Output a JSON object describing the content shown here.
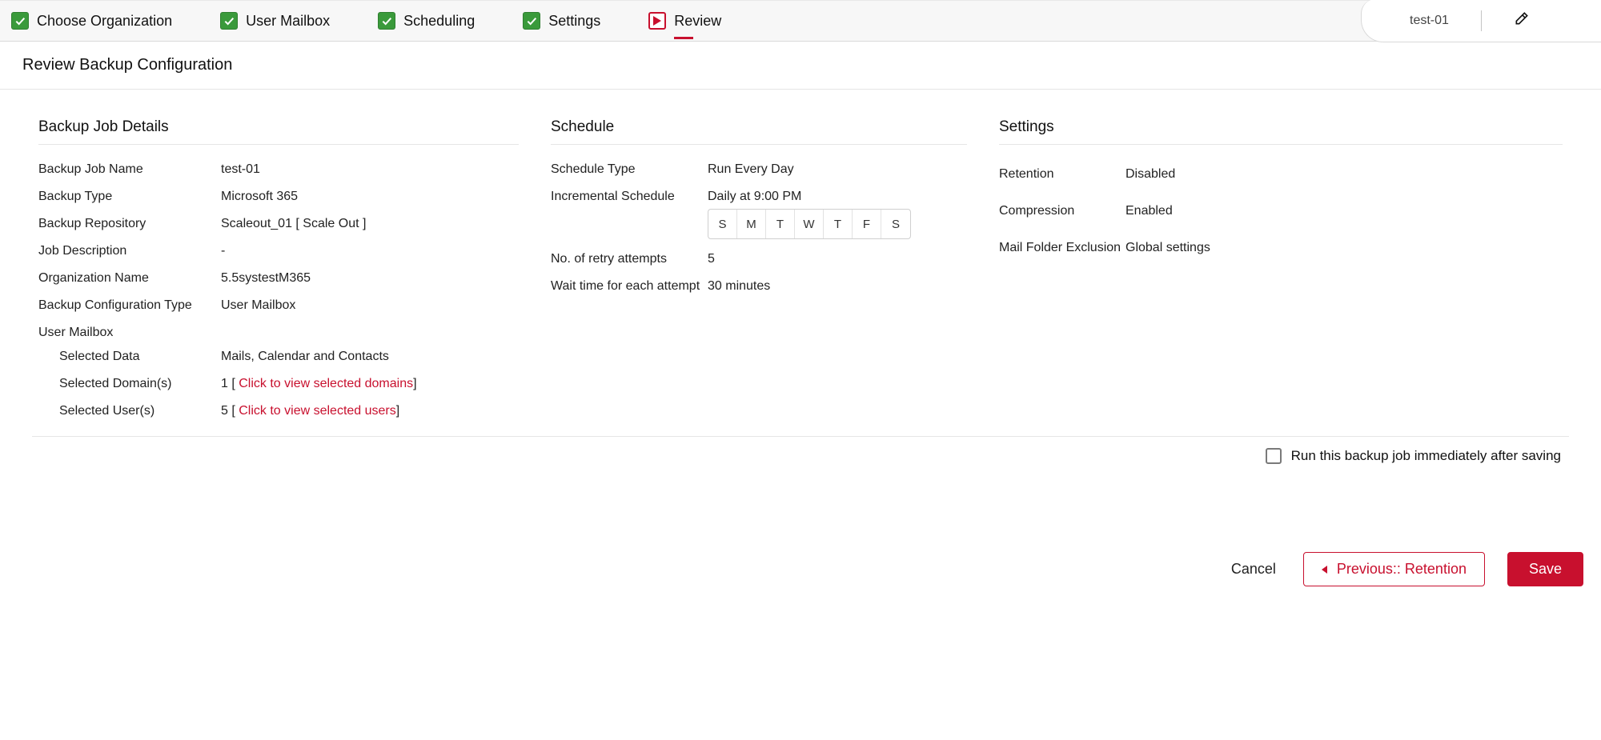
{
  "steps": {
    "s0": {
      "label": "Choose Organization",
      "state": "done"
    },
    "s1": {
      "label": "User Mailbox",
      "state": "done"
    },
    "s2": {
      "label": "Scheduling",
      "state": "done"
    },
    "s3": {
      "label": "Settings",
      "state": "done"
    },
    "s4": {
      "label": "Review",
      "state": "current"
    }
  },
  "header": {
    "job_name_short": "test-01"
  },
  "page_title": "Review Backup Configuration",
  "details": {
    "section_title": "Backup Job Details",
    "kv": {
      "job_name_label": "Backup Job Name",
      "job_name_value": "test-01",
      "type_label": "Backup Type",
      "type_value": "Microsoft 365",
      "repo_label": "Backup Repository",
      "repo_value": "Scaleout_01 [ Scale Out ]",
      "desc_label": "Job Description",
      "desc_value": "-",
      "org_label": "Organization Name",
      "org_value": "5.5systestM365",
      "conf_label": "Backup Configuration Type",
      "conf_value": "User Mailbox"
    },
    "group_label": "User Mailbox",
    "sel_data_label": "Selected Data",
    "sel_data_value": "Mails, Calendar and Contacts",
    "sel_dom_label": "Selected Domain(s)",
    "sel_dom_prefix": "1 [ ",
    "sel_dom_link": "Click to view selected domains",
    "sel_dom_suffix": "]",
    "sel_user_label": "Selected User(s)",
    "sel_user_prefix": "5 [ ",
    "sel_user_link": "Click to view selected users",
    "sel_user_suffix": "]"
  },
  "schedule": {
    "section_title": "Schedule",
    "type_label": "Schedule Type",
    "type_value": "Run Every Day",
    "inc_label": "Incremental Schedule",
    "inc_value": "Daily at 9:00 PM",
    "days": {
      "d0": "S",
      "d1": "M",
      "d2": "T",
      "d3": "W",
      "d4": "T",
      "d5": "F",
      "d6": "S"
    },
    "retry_label": "No. of retry attempts",
    "retry_value": "5",
    "wait_label": "Wait time for each attempt",
    "wait_value": "30 minutes"
  },
  "settings": {
    "section_title": "Settings",
    "ret_label": "Retention",
    "ret_value": "Disabled",
    "comp_label": "Compression",
    "comp_value": "Enabled",
    "mail_label": "Mail Folder Exclusion",
    "mail_value": "Global settings"
  },
  "run_option_label": "Run this backup job immediately after saving",
  "footer": {
    "cancel": "Cancel",
    "prev": "Previous:: Retention",
    "save": "Save"
  }
}
